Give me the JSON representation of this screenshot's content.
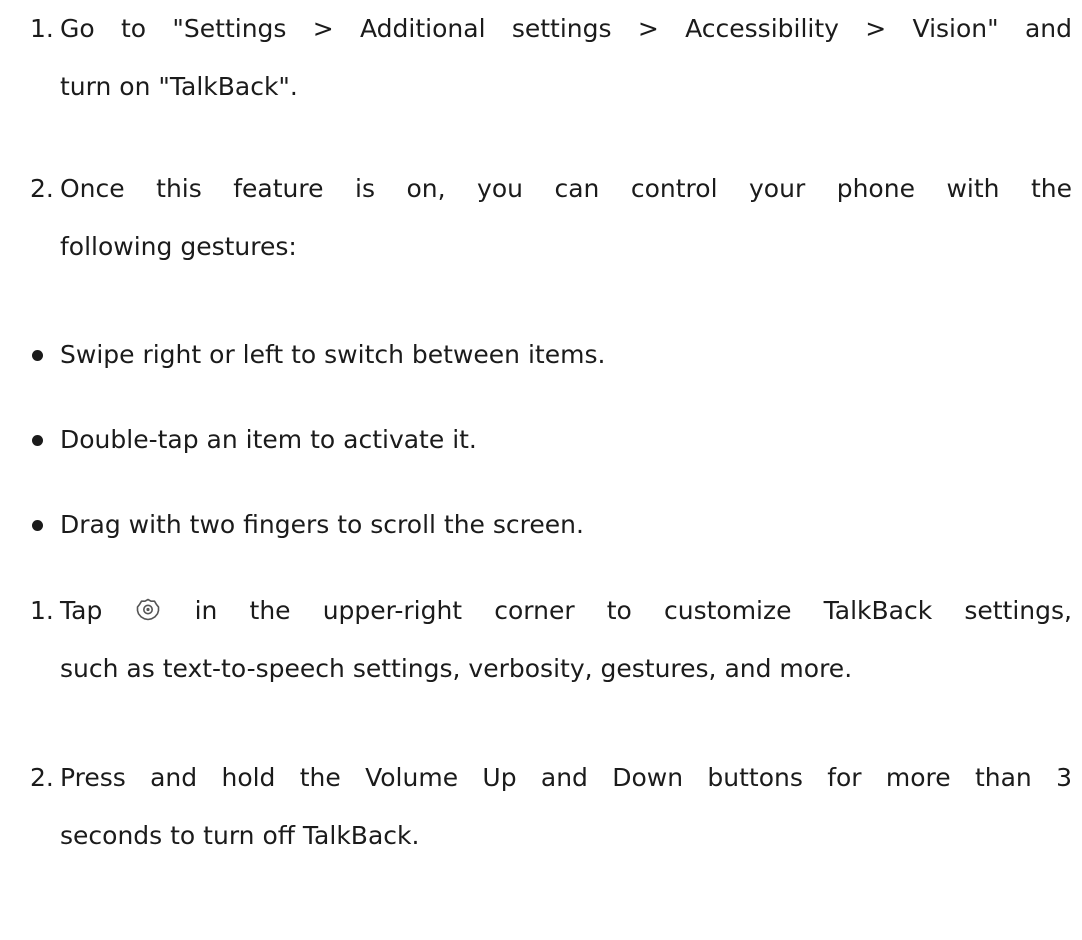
{
  "steps": [
    {
      "marker": "1.",
      "line1": "Go to \"Settings > Additional settings > Accessibility > Vision\" and",
      "line2": "turn on \"TalkBack\"."
    },
    {
      "marker": "2.",
      "line1": "Once this feature is on, you can control your phone with the",
      "line2": "following gestures:"
    }
  ],
  "bullets": [
    {
      "text": "Swipe right or left to switch between items."
    },
    {
      "text": "Double-tap an item to activate it."
    },
    {
      "text": "Drag with two fingers to scroll the screen."
    }
  ],
  "steps2": [
    {
      "marker": "1.",
      "before_icon": "Tap",
      "icon": "settings-gear-icon",
      "after_icon": "in the upper-right corner to customize TalkBack settings,",
      "line2": "such as text-to-speech settings, verbosity, gestures, and more."
    },
    {
      "marker": "2.",
      "line1": "Press and hold the Volume Up and Down buttons for more than 3",
      "line2": "seconds to turn off TalkBack."
    }
  ]
}
